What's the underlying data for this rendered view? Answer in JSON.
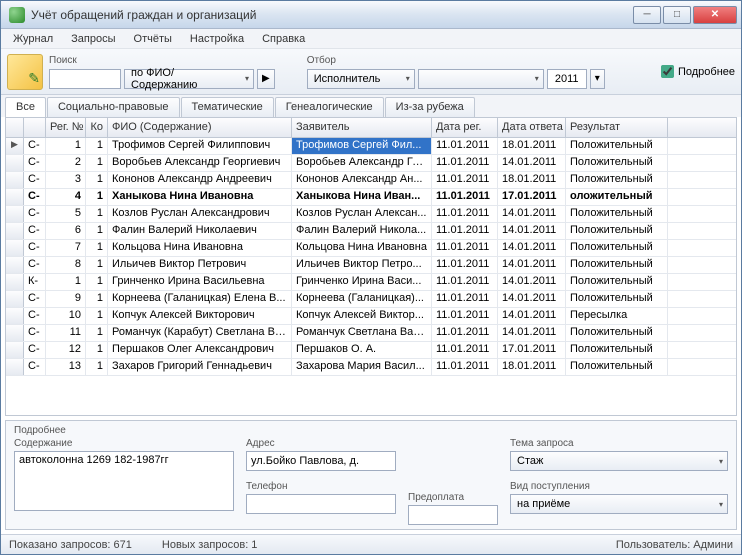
{
  "window": {
    "title": "Учёт обращений граждан и организаций"
  },
  "menu": {
    "items": [
      "Журнал",
      "Запросы",
      "Отчёты",
      "Настройка",
      "Справка"
    ]
  },
  "toolbar": {
    "search_label": "Поиск",
    "search_value": "",
    "search_by": "по ФИО/Содержанию",
    "filter_label": "Отбор",
    "filter_by": "Исполнитель",
    "filter_val": "",
    "year": "2011",
    "more_label": "Подробнее"
  },
  "tabs": [
    "Все",
    "Социально-правовые",
    "Тематические",
    "Генеалогические",
    "Из-за рубежа"
  ],
  "grid": {
    "columns": [
      "",
      "Рег. №",
      "Ко",
      "ФИО (Содержание)",
      "Заявитель",
      "Дата рег.",
      "Дата ответа",
      "Результат"
    ],
    "rows": [
      {
        "mark": "▶",
        "flag": "C-",
        "reg": "1",
        "ko": "1",
        "fio": "Трофимов Сергей Филиппович",
        "app": "Трофимов Сергей Фил...",
        "dr": "11.01.2011",
        "da": "18.01.2011",
        "res": "Положительный",
        "sel": true
      },
      {
        "flag": "C-",
        "reg": "2",
        "ko": "1",
        "fio": "Воробьев Александр Георгиевич",
        "app": "Воробьев Александр Ге...",
        "dr": "11.01.2011",
        "da": "14.01.2011",
        "res": "Положительный"
      },
      {
        "flag": "C-",
        "reg": "3",
        "ko": "1",
        "fio": "Кононов Александр Андреевич",
        "app": "Кононов Александр Ан...",
        "dr": "11.01.2011",
        "da": "18.01.2011",
        "res": "Положительный"
      },
      {
        "flag": "C-",
        "reg": "4",
        "ko": "1",
        "fio": "Ханыкова Нина Ивановна",
        "app": "Ханыкова Нина Иван...",
        "dr": "11.01.2011",
        "da": "17.01.2011",
        "res": "оложительный",
        "bold": true
      },
      {
        "flag": "C-",
        "reg": "5",
        "ko": "1",
        "fio": "Козлов Руслан Александрович",
        "app": "Козлов Руслан Алексан...",
        "dr": "11.01.2011",
        "da": "14.01.2011",
        "res": "Положительный"
      },
      {
        "flag": "C-",
        "reg": "6",
        "ko": "1",
        "fio": "Фалин Валерий Николаевич",
        "app": "Фалин Валерий Никола...",
        "dr": "11.01.2011",
        "da": "14.01.2011",
        "res": "Положительный"
      },
      {
        "flag": "C-",
        "reg": "7",
        "ko": "1",
        "fio": "Кольцова Нина Ивановна",
        "app": "Кольцова Нина Ивановна",
        "dr": "11.01.2011",
        "da": "14.01.2011",
        "res": "Положительный"
      },
      {
        "flag": "C-",
        "reg": "8",
        "ko": "1",
        "fio": "Ильичев Виктор Петрович",
        "app": "Ильичев Виктор Петро...",
        "dr": "11.01.2011",
        "da": "14.01.2011",
        "res": "Положительный"
      },
      {
        "flag": "К-",
        "reg": "1",
        "ko": "1",
        "fio": "Гринченко Ирина Васильевна",
        "app": "Гринченко Ирина Васи...",
        "dr": "11.01.2011",
        "da": "14.01.2011",
        "res": "Положительный"
      },
      {
        "flag": "C-",
        "reg": "9",
        "ko": "1",
        "fio": "Корнеева (Галаницкая) Елена В...",
        "app": "Корнеева (Галаницкая)...",
        "dr": "11.01.2011",
        "da": "14.01.2011",
        "res": "Положительный"
      },
      {
        "flag": "C-",
        "reg": "10",
        "ko": "1",
        "fio": "Копчук Алексей Викторович",
        "app": "Копчук Алексей Виктор...",
        "dr": "11.01.2011",
        "da": "14.01.2011",
        "res": "Пересылка"
      },
      {
        "flag": "C-",
        "reg": "11",
        "ko": "1",
        "fio": "Романчук (Карабут) Светлана Ва...",
        "app": "Романчук Светлана Вас...",
        "dr": "11.01.2011",
        "da": "14.01.2011",
        "res": "Положительный"
      },
      {
        "flag": "C-",
        "reg": "12",
        "ko": "1",
        "fio": "Першаков Олег Александрович",
        "app": "Першаков О. А.",
        "dr": "11.01.2011",
        "da": "17.01.2011",
        "res": "Положительный"
      },
      {
        "flag": "C-",
        "reg": "13",
        "ko": "1",
        "fio": "Захаров Григорий Геннадьевич",
        "app": "Захарова Мария Васил...",
        "dr": "11.01.2011",
        "da": "18.01.2011",
        "res": "Положительный"
      }
    ]
  },
  "details": {
    "title": "Подробнее",
    "content_label": "Содержание",
    "content_value": "автоколонна 1269 182-1987гг",
    "address_label": "Адрес",
    "address_value": "ул.Бойко Павлова, д.",
    "phone_label": "Телефон",
    "phone_value": "",
    "prepay_label": "Предоплата",
    "prepay_value": "",
    "topic_label": "Тема запроса",
    "topic_value": "Стаж",
    "source_label": "Вид поступления",
    "source_value": "на приёме"
  },
  "status": {
    "shown": "Показано запросов: 671",
    "new": "Новых запросов: 1",
    "user": "Пользователь: Админи"
  }
}
